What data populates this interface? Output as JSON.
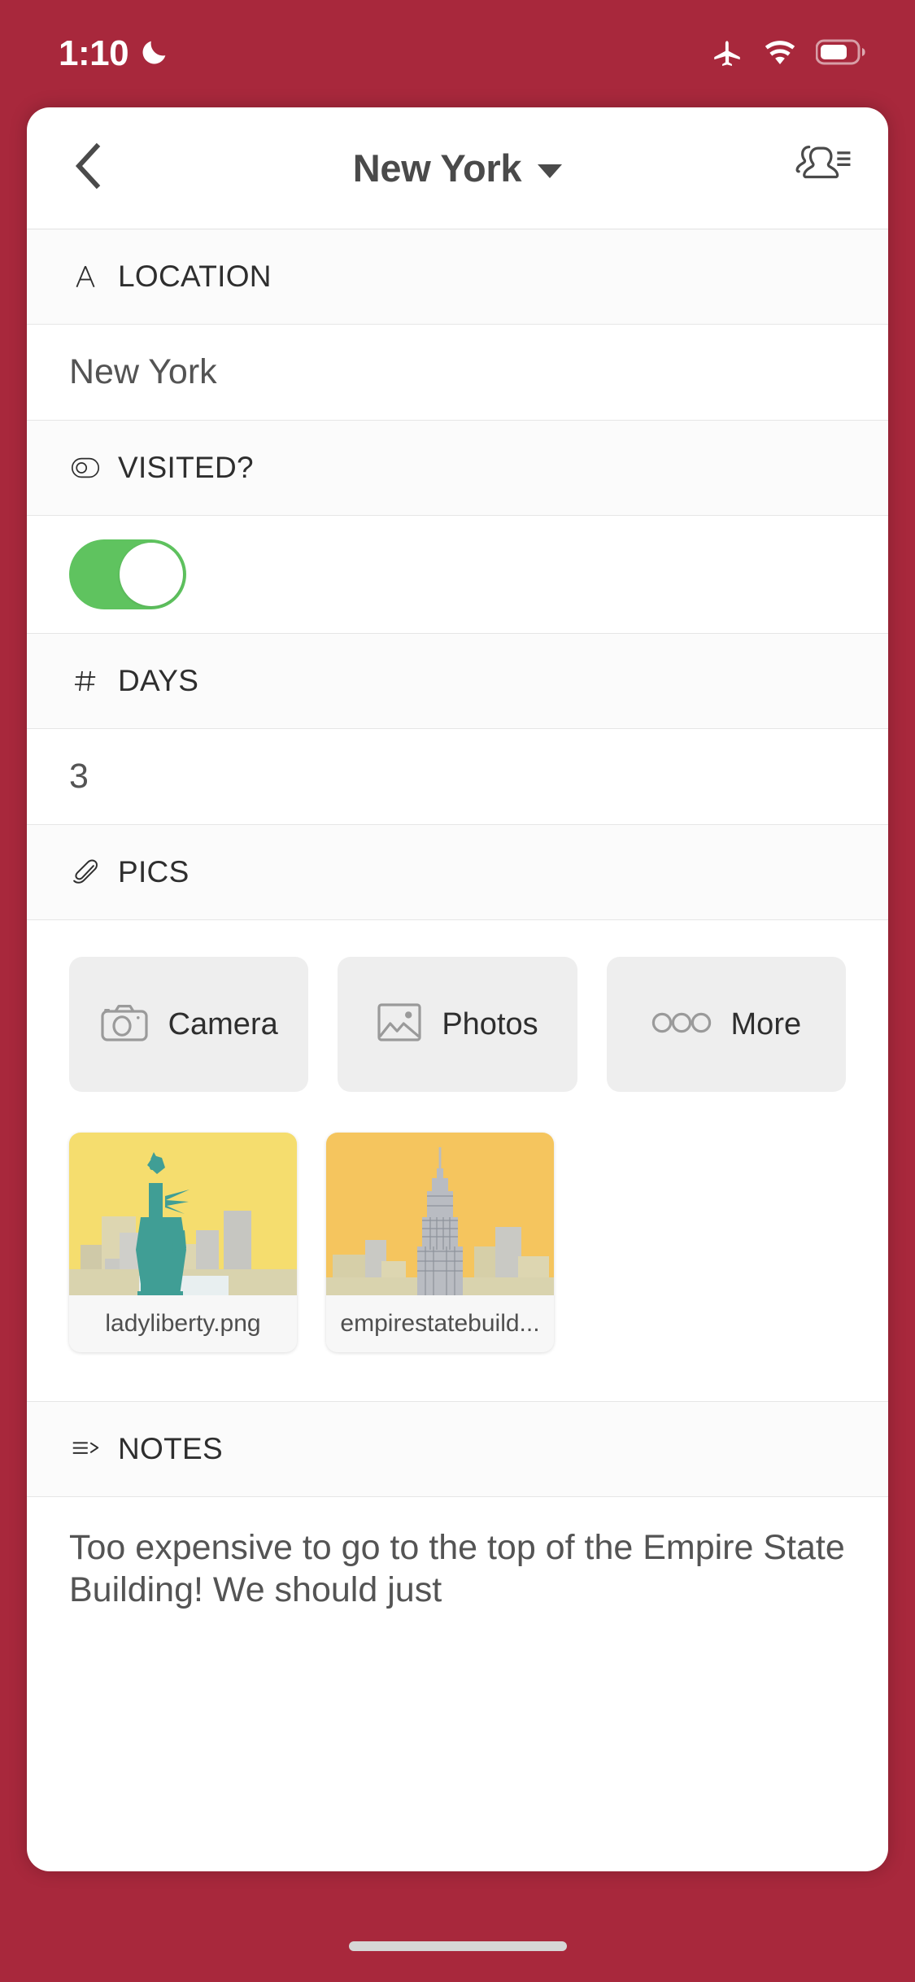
{
  "status_bar": {
    "time": "1:10",
    "icons": [
      "moon-icon",
      "airplane-mode-icon",
      "wifi-icon",
      "battery-icon"
    ]
  },
  "nav": {
    "back_icon": "chevron-left-icon",
    "title": "New York",
    "dropdown_icon": "chevron-down-icon",
    "right_icon": "contacts-list-icon"
  },
  "fields": {
    "location": {
      "icon": "text-field-icon",
      "label": "LOCATION",
      "value": "New York"
    },
    "visited": {
      "icon": "toggle-circle-icon",
      "label": "VISITED?",
      "value": "on"
    },
    "days": {
      "icon": "number-hash-icon",
      "label": "DAYS",
      "value": "3"
    },
    "pics": {
      "icon": "paperclip-icon",
      "label": "PICS",
      "buttons": [
        {
          "icon": "camera-icon",
          "label": "Camera"
        },
        {
          "icon": "photos-image-icon",
          "label": "Photos"
        },
        {
          "icon": "ellipsis-circles-icon",
          "label": "More"
        }
      ],
      "thumbnails": [
        {
          "name": "ladyliberty.png",
          "subject": "statue-of-liberty"
        },
        {
          "name": "empirestatebuild...",
          "subject": "empire-state-building"
        }
      ]
    },
    "notes": {
      "icon": "notes-lines-icon",
      "label": "NOTES",
      "value": "Too expensive to go to the top of the Empire State Building! We should just"
    }
  },
  "colors": {
    "background": "#a8283c",
    "toggle_on": "#5fc35f",
    "card": "#ffffff",
    "button_bg": "#eeeeee",
    "sky_1": "#f5dd6e",
    "sky_2": "#f5c55e",
    "statue": "#409e95"
  }
}
